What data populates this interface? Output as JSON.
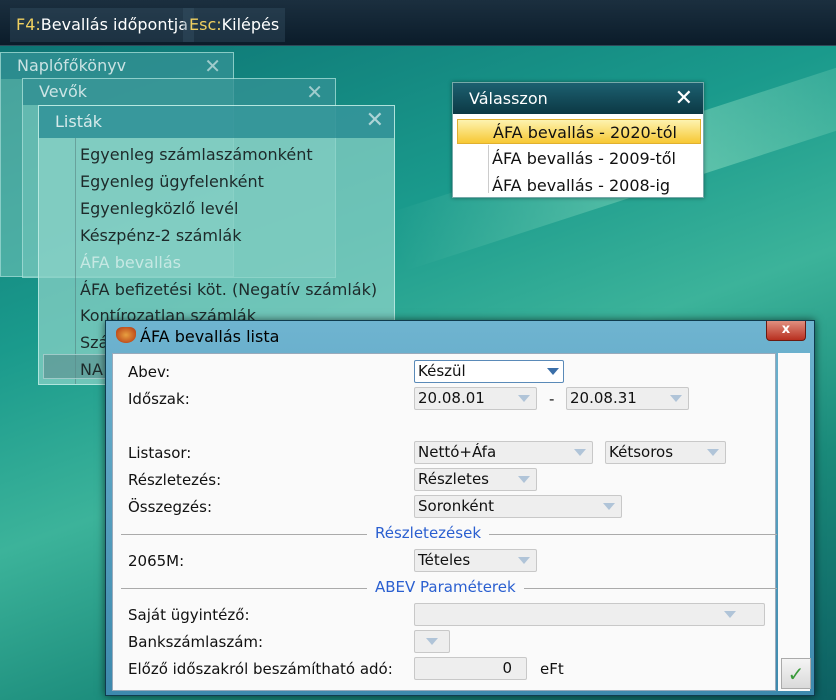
{
  "topbar": {
    "buttons": [
      {
        "key": "F4:",
        "label": "Bevallás időpontja"
      },
      {
        "key": "Esc:",
        "label": "Kilépés"
      }
    ]
  },
  "windows": {
    "naplofokonyv": "Naplófőkönyv",
    "vevok": "Vevők",
    "listak": "Listák"
  },
  "menu": {
    "items": [
      "Egyenleg számlaszámonként",
      "Egyenleg ügyfelenként",
      "Egyenlegközlő levél",
      "Készpénz-2 számlák",
      "ÁFA bevallás",
      "ÁFA befizetési köt. (Negatív számlák)",
      "Kontírozatlan számlák",
      "Szá",
      "NA"
    ],
    "selected_index": 4
  },
  "chooser": {
    "title": "Válasszon",
    "items": [
      "ÁFA bevallás - 2020-tól",
      "ÁFA bevallás - 2009-től",
      "ÁFA bevallás - 2008-ig"
    ],
    "selected_index": 0
  },
  "dialog": {
    "title": "ÁFA bevallás lista",
    "close": "x",
    "abev": {
      "label": "Abev:",
      "value": "Készül"
    },
    "idoszak": {
      "label": "Időszak:",
      "from": "20.08.01",
      "sep": "-",
      "to": "20.08.31"
    },
    "listasor": {
      "label": "Listasor:",
      "value": "Nettó+Áfa",
      "value2": "Kétsoros"
    },
    "reszletezes": {
      "label": "Részletezés:",
      "value": "Részletes"
    },
    "osszegzes": {
      "label": "Összegzés:",
      "value": "Soronként"
    },
    "section1": "Részletezések",
    "m2065": {
      "label": "2065M:",
      "value": "Tételes"
    },
    "section2": "ABEV Paraméterek",
    "ugyintezo": {
      "label": "Saját ügyintéző:",
      "value": ""
    },
    "bankszamla": {
      "label": "Bankszámlaszám:",
      "value": ""
    },
    "elozo": {
      "label": "Előző időszakról beszámítható adó:",
      "value": "0",
      "unit": "eFt"
    },
    "ok": "✓"
  }
}
